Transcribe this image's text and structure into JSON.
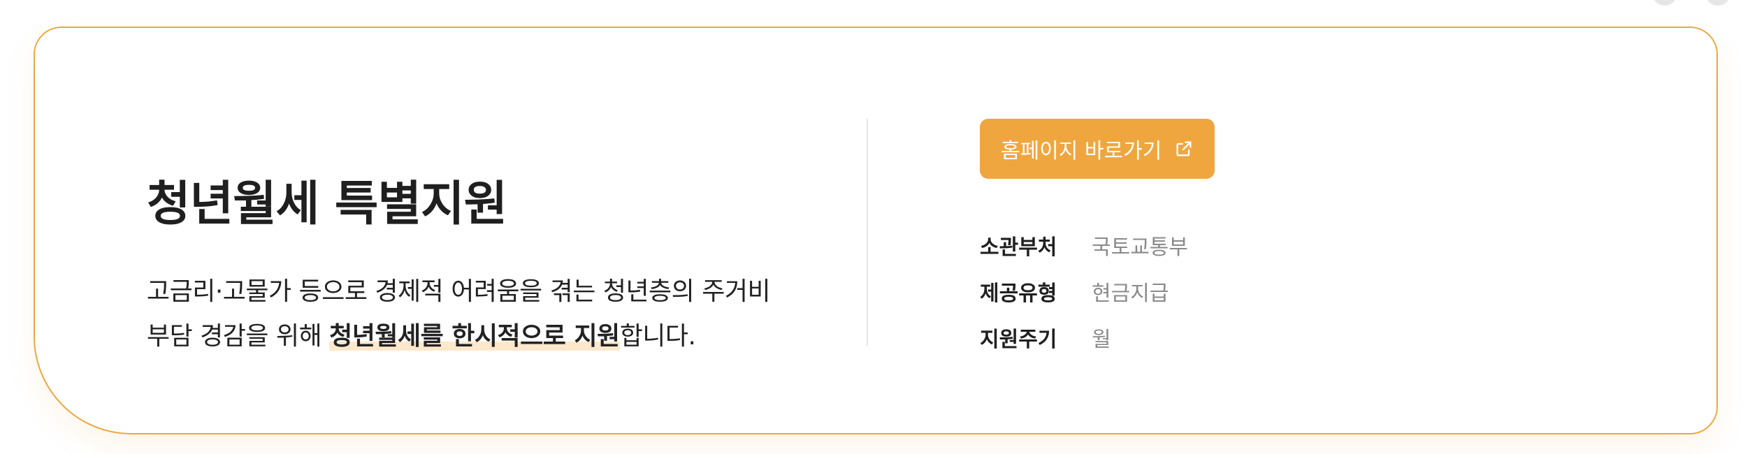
{
  "program": {
    "title": "청년월세 특별지원",
    "description": {
      "line1": "고금리·고물가 등으로 경제적 어려움을 겪는 청년층의 주거비",
      "line2_prefix": "부담 경감을 위해 ",
      "line2_emphasis": "청년월세를 한시적으로 지원",
      "line2_suffix": "합니다."
    }
  },
  "actions": {
    "homepage_button_label": "홈페이지 바로가기",
    "homepage_button_icon": "external-link-icon"
  },
  "details": [
    {
      "label": "소관부처",
      "value": "국토교통부"
    },
    {
      "label": "제공유형",
      "value": "현금지급"
    },
    {
      "label": "지원주기",
      "value": "월"
    }
  ],
  "colors": {
    "accent": "#f0a63f",
    "highlight": "#fde8cc",
    "title_text": "#1f1f1f",
    "muted_text": "#8a8a8a"
  }
}
